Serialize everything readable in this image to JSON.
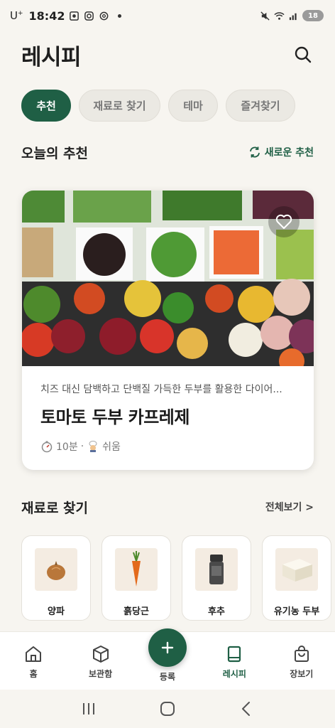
{
  "status_bar": {
    "carrier": "U",
    "carrier_sup": "+",
    "time": "18:42",
    "battery": "18"
  },
  "header": {
    "title": "레시피"
  },
  "tabs": [
    {
      "label": "추천",
      "active": true
    },
    {
      "label": "재료로 찾기",
      "active": false
    },
    {
      "label": "테마",
      "active": false
    },
    {
      "label": "즐겨찾기",
      "active": false
    }
  ],
  "today": {
    "title": "오늘의 추천",
    "refresh_label": "새로운 추천"
  },
  "recipe": {
    "description": "치즈 대신 담백하고 단백질 가득한 두부를 활용한 다이어...",
    "title": "토마토 두부 카프레제",
    "time": "10분",
    "separator": "·",
    "difficulty": "쉬움"
  },
  "ingredients_section": {
    "title": "재료로 찾기",
    "see_all": "전체보기 >",
    "items": [
      {
        "label": "양파",
        "icon": "onion-icon"
      },
      {
        "label": "흙당근",
        "icon": "carrot-icon"
      },
      {
        "label": "후추",
        "icon": "pepper-icon"
      },
      {
        "label": "유기농 두부",
        "icon": "tofu-icon"
      }
    ]
  },
  "bottom_nav": {
    "items": [
      {
        "label": "홈",
        "icon": "home-icon"
      },
      {
        "label": "보관함",
        "icon": "box-icon"
      },
      {
        "label": "등록",
        "icon": "plus-icon"
      },
      {
        "label": "레시피",
        "icon": "book-icon",
        "active": true
      },
      {
        "label": "장보기",
        "icon": "shopping-bag-icon"
      }
    ]
  },
  "colors": {
    "accent": "#1f5f45",
    "background": "#f7f5f0"
  }
}
